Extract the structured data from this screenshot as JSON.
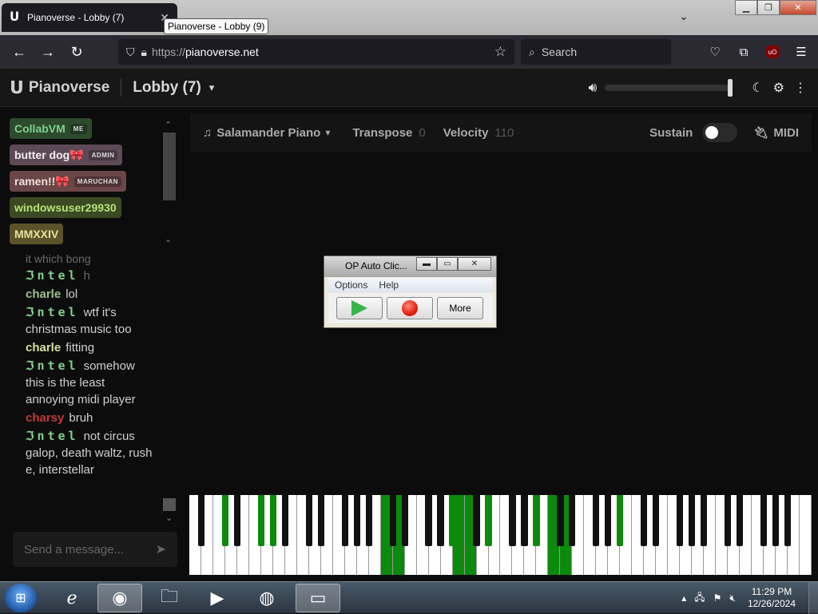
{
  "browser": {
    "tab_title": "Pianoverse - Lobby (7)",
    "tooltip": "Pianoverse - Lobby (9)",
    "url_proto": "https://",
    "url_host": "pianoverse.net",
    "search_placeholder": "Search",
    "ublock_label": "uO"
  },
  "app": {
    "logo_text": "Pianoverse",
    "lobby_title": "Lobby (7)",
    "volume_level": 1.0
  },
  "users": [
    {
      "name": "CollabVM",
      "badge": "ME",
      "color": "#7fd08a",
      "bg": "#2d4a2d"
    },
    {
      "name": "butter dog🎀",
      "badge": "ADMIN",
      "color": "#f0f0f0",
      "bg": "#5e4a56"
    },
    {
      "name": "ramen!!🎀",
      "badge": "MARUCHAN",
      "color": "#f0e0e0",
      "bg": "#6a4646"
    },
    {
      "name": "windowsuser29930",
      "badge": "",
      "color": "#b8e07a",
      "bg": "#3b4a22"
    },
    {
      "name": "MMXXIV",
      "badge": "",
      "color": "#e8e0a0",
      "bg": "#5a5228"
    }
  ],
  "chat": {
    "faded_line": "it which bong",
    "messages": [
      {
        "nick": "ℑntel",
        "color": "#7fd08a",
        "text": "h",
        "text_faded": true
      },
      {
        "nick": "charle",
        "color": "#9bc08a",
        "text": "lol"
      },
      {
        "nick": "ℑntel",
        "color": "#7fd08a",
        "text": "wtf it's christmas music too"
      },
      {
        "nick": "charle",
        "color": "#d8e0a0",
        "text": "fitting"
      },
      {
        "nick": "ℑntel",
        "color": "#7fd08a",
        "text": "somehow this is the least annoying midi player"
      },
      {
        "nick": "charsy",
        "color": "#c03a3a",
        "text": "bruh"
      },
      {
        "nick": "ℑntel",
        "color": "#7fd08a",
        "text": "not circus galop, death waltz, rush e, interstellar"
      }
    ],
    "input_placeholder": "Send a message..."
  },
  "piano_bar": {
    "instrument": "Salamander Piano",
    "transpose_label": "Transpose",
    "transpose_value": "0",
    "velocity_label": "Velocity",
    "velocity_value": "110",
    "sustain_label": "Sustain",
    "midi_label": "MIDI"
  },
  "popup": {
    "title": "OP Auto Clic...",
    "menu_options": "Options",
    "menu_help": "Help",
    "more_label": "More"
  },
  "piano": {
    "pressed_white": [
      16,
      17,
      22,
      23,
      30,
      31
    ],
    "pressed_black": [
      1,
      3,
      4,
      15,
      17,
      20,
      25
    ]
  },
  "taskbar": {
    "time": "11:29 PM",
    "date": "12/26/2024"
  },
  "colors": {
    "accent_green": "#0b8a0b",
    "page_bg": "#0c0c0c"
  }
}
